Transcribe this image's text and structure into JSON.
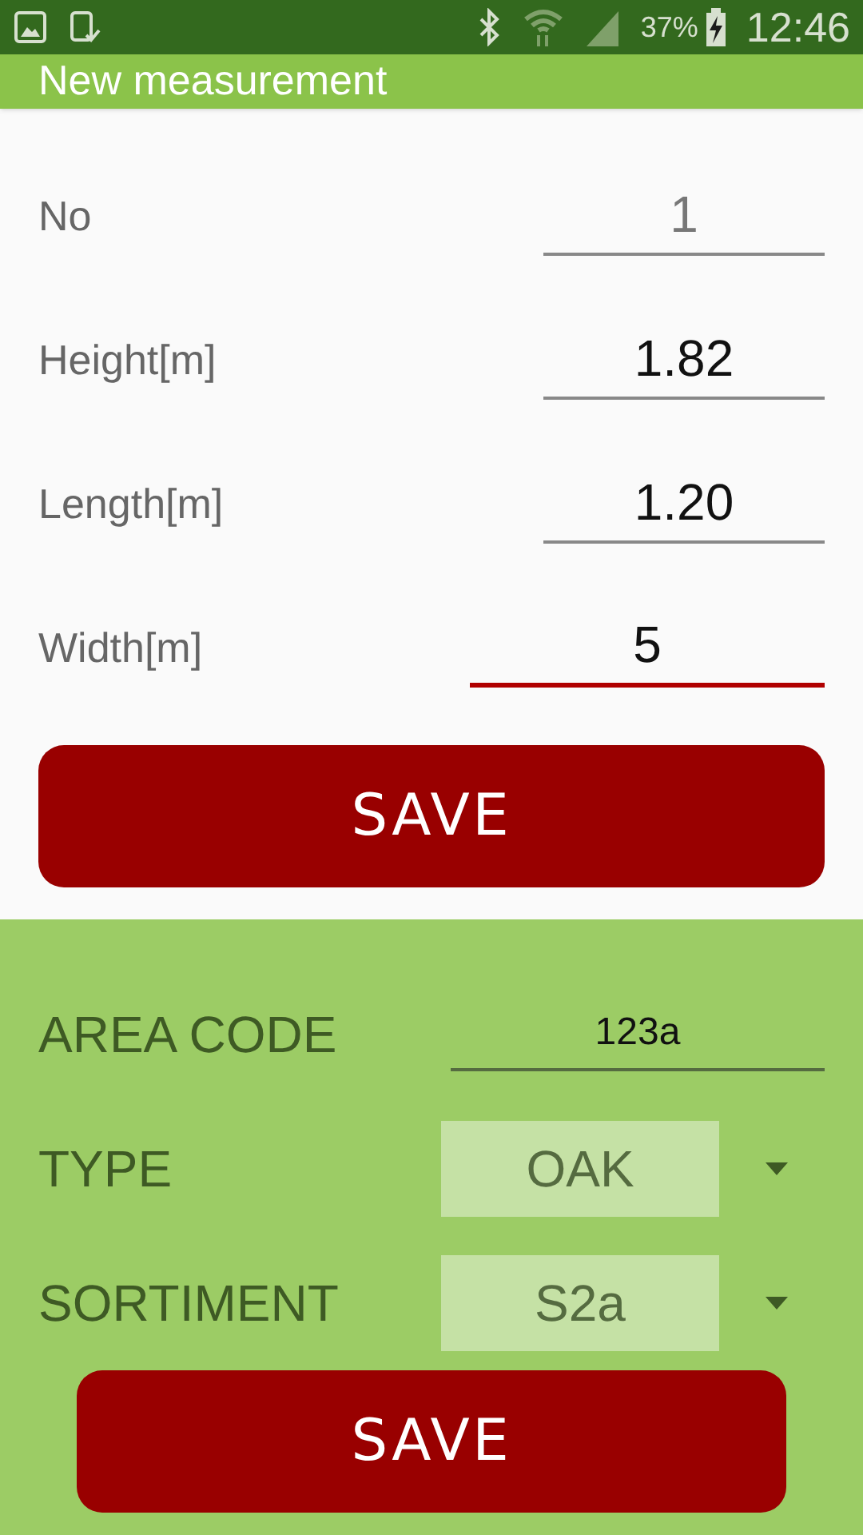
{
  "status_bar": {
    "battery": "37%",
    "time": "12:46"
  },
  "app_bar": {
    "title": "New measurement"
  },
  "fields": [
    {
      "label": "No",
      "value": "1",
      "disabled": true,
      "focused": false
    },
    {
      "label": "Height[m]",
      "value": "1.82",
      "disabled": false,
      "focused": false
    },
    {
      "label": "Length[m]",
      "value": "1.20",
      "disabled": false,
      "focused": false
    },
    {
      "label": "Width[m]",
      "value": "5",
      "disabled": false,
      "focused": true
    }
  ],
  "save_button": "SAVE",
  "settings": [
    {
      "kind": "text",
      "label": "AREA CODE",
      "value": "123a"
    },
    {
      "kind": "dropdown",
      "label": "TYPE",
      "value": "OAK"
    },
    {
      "kind": "dropdown",
      "label": "SORTIMENT",
      "value": "S2a"
    }
  ],
  "bottom_save_button": "SAVE"
}
